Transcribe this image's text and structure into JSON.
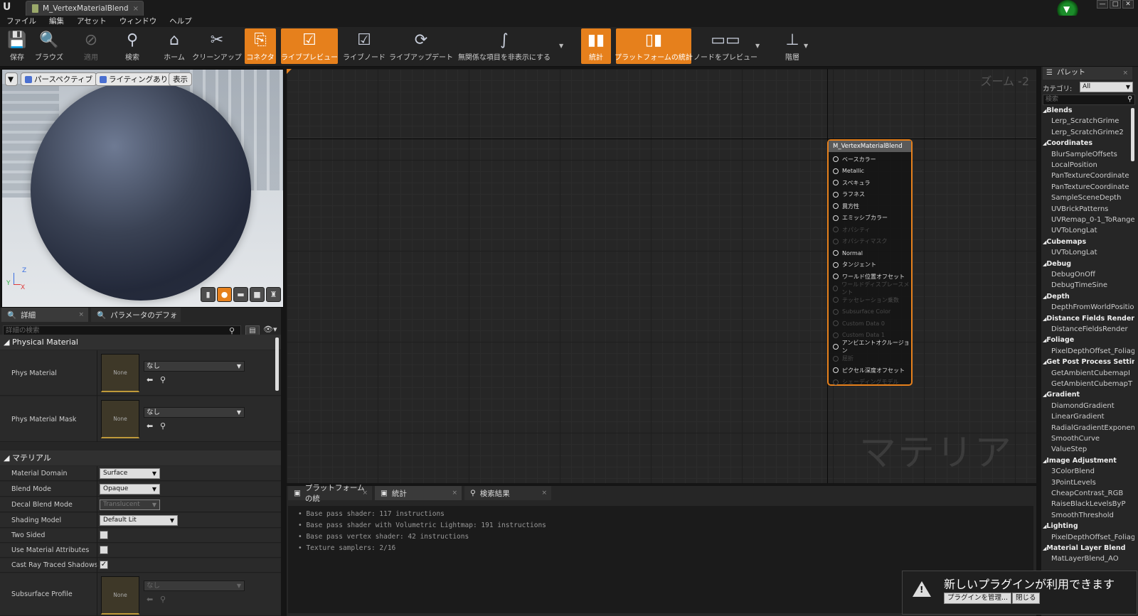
{
  "window": {
    "tab_title": "M_VertexMaterialBlend",
    "close": "×",
    "controls": [
      "—",
      "□",
      "✕"
    ]
  },
  "menu": [
    "ファイル",
    "編集",
    "アセット",
    "ウィンドウ",
    "ヘルプ"
  ],
  "toolbar": {
    "save": "保存",
    "browse": "ブラウズ",
    "apply": "適用",
    "search": "検索",
    "home": "ホーム",
    "cleanup": "クリーンアップ",
    "connector": "コネクタ",
    "live_preview": "ライブプレビュー",
    "live_nodes": "ライブノード",
    "live_update": "ライブアップデート",
    "hide_unrelated": "無関係な項目を非表示にする",
    "stats": "統計",
    "platform_stats": "プラットフォームの統計",
    "preview_nodes": "ノードをプレビュー",
    "hierarchy": "階層"
  },
  "viewport": {
    "perspective": "パースペクティブ",
    "lighting": "ライティングあり",
    "show": "表示",
    "axis_z": "Z",
    "axis_y": "Y",
    "axis_x": "X"
  },
  "details": {
    "tab_details": "詳細",
    "tab_params": "パラメータのデフォ",
    "search_placeholder": "詳細の検索",
    "sec_physical": "Physical Material",
    "phys_material": "Phys Material",
    "phys_material_mask": "Phys Material Mask",
    "none": "None",
    "nashi": "なし",
    "sec_material": "マテリアル",
    "material_domain": "Material Domain",
    "material_domain_val": "Surface",
    "blend_mode": "Blend Mode",
    "blend_mode_val": "Opaque",
    "decal_blend_mode": "Decal Blend Mode",
    "decal_blend_mode_val": "Translucent",
    "shading_model": "Shading Model",
    "shading_model_val": "Default Lit",
    "two_sided": "Two Sided",
    "use_material_attributes": "Use Material Attributes",
    "cast_ray_traced_shadows": "Cast Ray Traced Shadows",
    "subsurface_profile": "Subsurface Profile"
  },
  "graph": {
    "zoom": "ズーム -2",
    "watermark": "マテリアル",
    "node_title": "M_VertexMaterialBlend",
    "pins": [
      {
        "label": "ベースカラー",
        "enabled": true
      },
      {
        "label": "Metallic",
        "enabled": true
      },
      {
        "label": "スペキュラ",
        "enabled": true
      },
      {
        "label": "ラフネス",
        "enabled": true
      },
      {
        "label": "異方性",
        "enabled": true
      },
      {
        "label": "エミッシブカラー",
        "enabled": true
      },
      {
        "label": "オパシティ",
        "enabled": false
      },
      {
        "label": "オパシティマスク",
        "enabled": false
      },
      {
        "label": "Normal",
        "enabled": true
      },
      {
        "label": "タンジェント",
        "enabled": true
      },
      {
        "label": "ワールド位置オフセット",
        "enabled": true
      },
      {
        "label": "ワールドディスプレースメント",
        "enabled": false
      },
      {
        "label": "テッセレーション乗数",
        "enabled": false
      },
      {
        "label": "Subsurface Color",
        "enabled": false
      },
      {
        "label": "Custom Data 0",
        "enabled": false
      },
      {
        "label": "Custom Data 1",
        "enabled": false
      },
      {
        "label": "アンビエントオクルージョン",
        "enabled": true
      },
      {
        "label": "屈折",
        "enabled": false
      },
      {
        "label": "ピクセル深度オフセット",
        "enabled": true
      },
      {
        "label": "シェーディングモデル",
        "enabled": false
      }
    ]
  },
  "output": {
    "tab_platform": "プラットフォームの統",
    "tab_stats": "統計",
    "tab_results": "検索結果",
    "lines": [
      "• Base pass shader: 117 instructions",
      "• Base pass shader with Volumetric Lightmap: 191 instructions",
      "• Base pass vertex shader: 42 instructions",
      "• Texture samplers: 2/16"
    ]
  },
  "palette": {
    "tab": "パレット",
    "category_label": "カテゴリ:",
    "category_value": "All",
    "search_placeholder": "検索",
    "tree": [
      {
        "cat": "Blends",
        "items": [
          "Lerp_ScratchGrime",
          "Lerp_ScratchGrime2"
        ]
      },
      {
        "cat": "Coordinates",
        "items": [
          "BlurSampleOffsets",
          "LocalPosition",
          "PanTextureCoordinate",
          "PanTextureCoordinate",
          "SampleSceneDepth",
          "UVBrickPatterns",
          "UVRemap_0-1_ToRange",
          "UVToLongLat"
        ]
      },
      {
        "cat": "Cubemaps",
        "items": [
          "UVToLongLat"
        ]
      },
      {
        "cat": "Debug",
        "items": [
          "DebugOnOff",
          "DebugTimeSine"
        ]
      },
      {
        "cat": "Depth",
        "items": [
          "DepthFromWorldPosition"
        ]
      },
      {
        "cat": "Distance Fields Rendering",
        "items": [
          "DistanceFieldsRender"
        ]
      },
      {
        "cat": "Foliage",
        "items": [
          "PixelDepthOffset_Foliage"
        ]
      },
      {
        "cat": "Get Post Process Settings",
        "items": [
          "GetAmbientCubemapI",
          "GetAmbientCubemapT"
        ]
      },
      {
        "cat": "Gradient",
        "items": [
          "DiamondGradient",
          "LinearGradient",
          "RadialGradientExponential",
          "SmoothCurve",
          "ValueStep"
        ]
      },
      {
        "cat": "Image Adjustment",
        "items": [
          "3ColorBlend",
          "3PointLevels",
          "CheapContrast_RGB",
          "RaiseBlackLevelsByP",
          "SmoothThreshold"
        ]
      },
      {
        "cat": "Lighting",
        "items": [
          "PixelDepthOffset_Foliage"
        ]
      },
      {
        "cat": "Material Layer Blend",
        "items": [
          "MatLayerBlend_AO"
        ]
      }
    ]
  },
  "toast": {
    "text": "新しいプラグインが利用できます",
    "manage": "プラグインを管理...",
    "close": "閉じる"
  },
  "colors": {
    "accent": "#e6801c",
    "bg": "#151515",
    "panel": "#262626"
  }
}
